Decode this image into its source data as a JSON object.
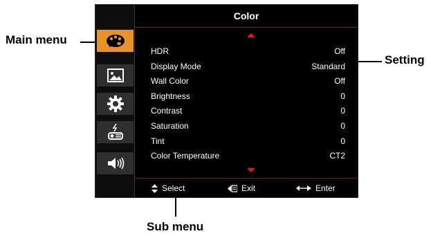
{
  "callouts": {
    "main_menu": "Main menu",
    "setting": "Setting",
    "sub_menu": "Sub menu"
  },
  "osd": {
    "title": "Color",
    "sidebar": [
      {
        "icon": "palette-icon",
        "active": true
      },
      {
        "icon": "picture-icon",
        "active": false
      },
      {
        "icon": "gear-icon",
        "active": false
      },
      {
        "icon": "projector-icon",
        "active": false
      },
      {
        "icon": "speaker-icon",
        "active": false
      }
    ],
    "items": [
      {
        "label": "HDR",
        "value": "Off"
      },
      {
        "label": "Display Mode",
        "value": "Standard"
      },
      {
        "label": "Wall Color",
        "value": "Off"
      },
      {
        "label": "Brightness",
        "value": "0"
      },
      {
        "label": "Contrast",
        "value": "0"
      },
      {
        "label": "Saturation",
        "value": "0"
      },
      {
        "label": "Tint",
        "value": "0"
      },
      {
        "label": "Color Temperature",
        "value": "CT2"
      }
    ],
    "hints": {
      "select": "Select",
      "exit": "Exit",
      "enter": "Enter"
    }
  },
  "colors": {
    "accent": "#e8932a",
    "arrow": "#e8101e",
    "background": "#000000"
  }
}
